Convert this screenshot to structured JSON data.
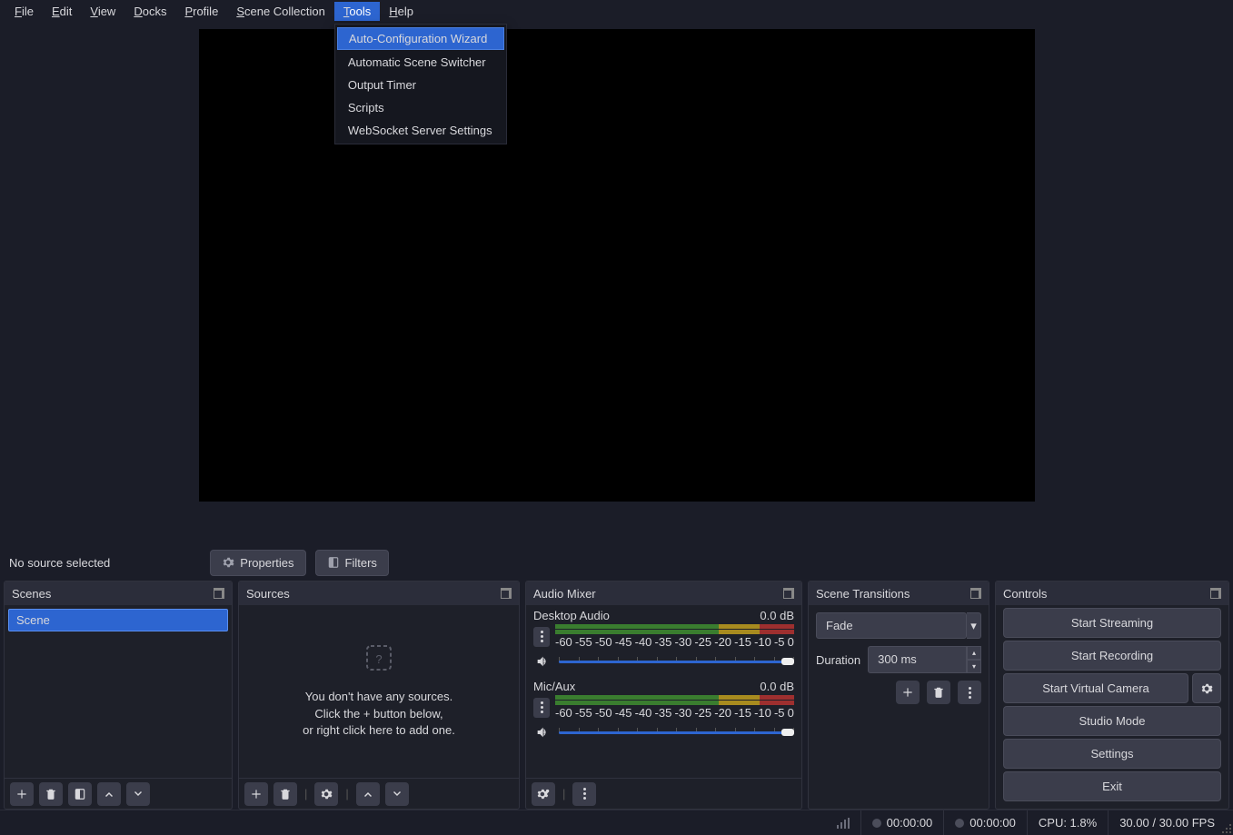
{
  "menubar": {
    "items": [
      {
        "u": "F",
        "rest": "ile"
      },
      {
        "u": "E",
        "rest": "dit"
      },
      {
        "u": "V",
        "rest": "iew"
      },
      {
        "u": "D",
        "rest": "ocks"
      },
      {
        "u": "P",
        "rest": "rofile"
      },
      {
        "u": "S",
        "rest": "cene Collection"
      },
      {
        "u": "T",
        "rest": "ools"
      },
      {
        "u": "H",
        "rest": "elp"
      }
    ],
    "open_index": 6,
    "dropdown": [
      "Auto-Configuration Wizard",
      "Automatic Scene Switcher",
      "Output Timer",
      "Scripts",
      "WebSocket Server Settings"
    ],
    "dropdown_hl": 0
  },
  "src_toolbar": {
    "status": "No source selected",
    "properties": "Properties",
    "filters": "Filters"
  },
  "panels": {
    "scenes": {
      "title": "Scenes",
      "items": [
        "Scene"
      ]
    },
    "sources": {
      "title": "Sources",
      "empty_l1": "You don't have any sources.",
      "empty_l2": "Click the + button below,",
      "empty_l3": "or right click here to add one."
    },
    "mixer": {
      "title": "Audio Mixer",
      "channels": [
        {
          "name": "Desktop Audio",
          "level": "0.0 dB"
        },
        {
          "name": "Mic/Aux",
          "level": "0.0 dB"
        }
      ],
      "scale": [
        "-60",
        "-55",
        "-50",
        "-45",
        "-40",
        "-35",
        "-30",
        "-25",
        "-20",
        "-15",
        "-10",
        "-5",
        "0"
      ]
    },
    "transitions": {
      "title": "Scene Transitions",
      "selected": "Fade",
      "duration_label": "Duration",
      "duration_value": "300 ms"
    },
    "controls": {
      "title": "Controls",
      "buttons": {
        "stream": "Start Streaming",
        "record": "Start Recording",
        "vcam": "Start Virtual Camera",
        "studio": "Studio Mode",
        "settings": "Settings",
        "exit": "Exit"
      }
    }
  },
  "status": {
    "live_time": "00:00:00",
    "rec_time": "00:00:00",
    "cpu": "CPU: 1.8%",
    "fps": "30.00 / 30.00 FPS"
  }
}
